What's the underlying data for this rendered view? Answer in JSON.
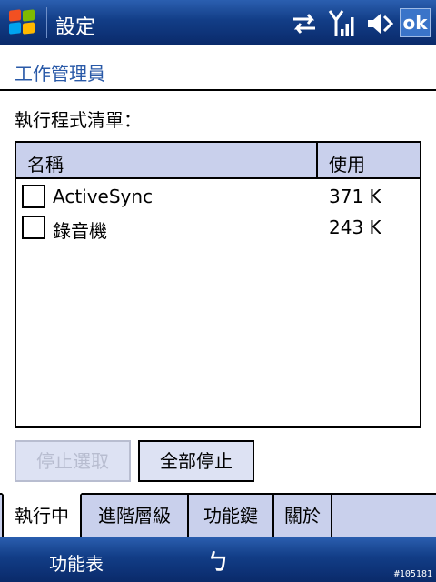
{
  "titlebar": {
    "app_title": "設定",
    "ok_label": "ok",
    "icons": [
      "windows-start-icon",
      "sync-arrows-icon",
      "signal-strength-icon",
      "speaker-icon"
    ]
  },
  "header": {
    "title": "工作管理員"
  },
  "list": {
    "caption": "執行程式清單：",
    "columns": [
      "名稱",
      "使用"
    ],
    "rows": [
      {
        "name": "ActiveSync",
        "usage": "371 K",
        "checked": false
      },
      {
        "name": "錄音機",
        "usage": "243 K",
        "checked": false
      }
    ]
  },
  "buttons": {
    "stop_selected": "停止選取",
    "stop_all": "全部停止"
  },
  "tabs": [
    {
      "label": "執行中",
      "active": true
    },
    {
      "label": "進階層級",
      "active": false
    },
    {
      "label": "功能鍵",
      "active": false
    },
    {
      "label": "關於",
      "active": false
    }
  ],
  "softkeys": {
    "left": "功能表",
    "sip_symbol": "ㄅ"
  },
  "watermark": "#105181",
  "colors": {
    "title_bar": "#123d86",
    "header_text": "#2a5aa8",
    "list_header_bg": "#c9d0ec",
    "disabled_text": "#b8bdd0"
  }
}
